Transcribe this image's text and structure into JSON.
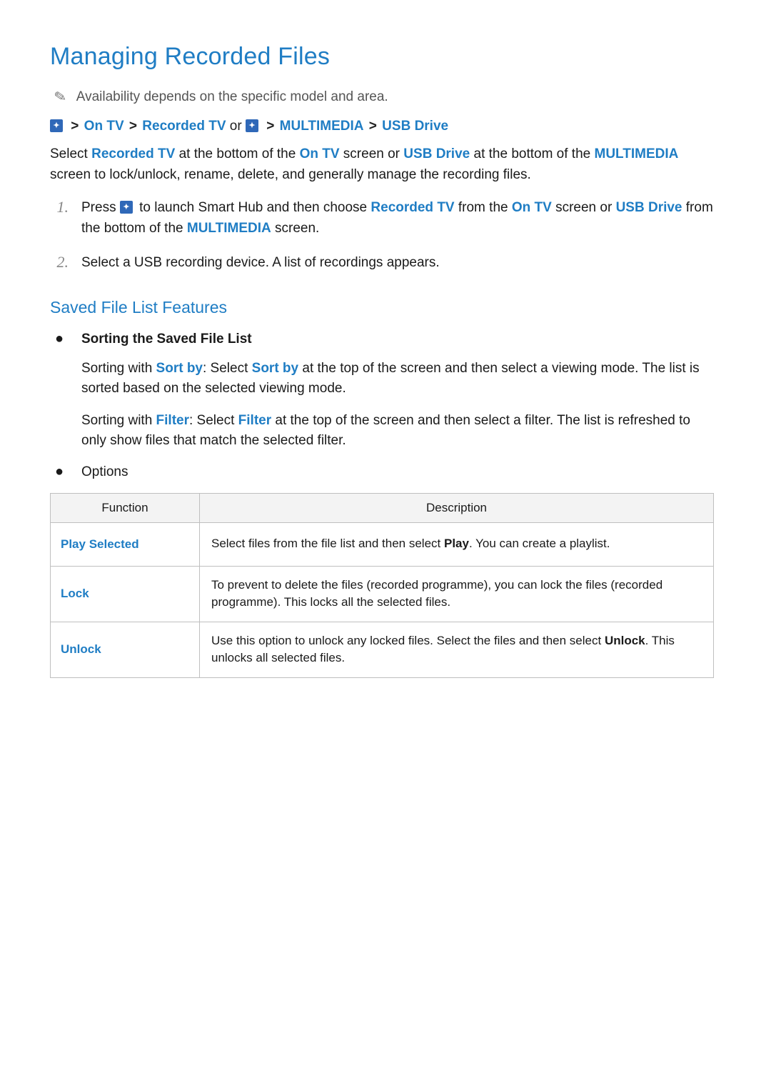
{
  "title": "Managing Recorded Files",
  "note": "Availability depends on the specific model and area.",
  "breadcrumb": {
    "path1": {
      "seg1": "On TV",
      "seg2": "Recorded TV"
    },
    "or": "or",
    "path2": {
      "seg1": "MULTIMEDIA",
      "seg2": "USB Drive"
    },
    "sep": ">"
  },
  "intro": {
    "pre1": "Select ",
    "kw1": "Recorded TV",
    "mid1": " at the bottom of the ",
    "kw2": "On TV",
    "mid2": " screen or ",
    "kw3": "USB Drive",
    "mid3": " at the bottom of the ",
    "kw4": "MULTIMEDIA",
    "post": " screen to lock/unlock, rename, delete, and generally manage the recording files."
  },
  "steps": [
    {
      "num": "1.",
      "pre": "Press ",
      "mid1": " to launch Smart Hub and then choose ",
      "kw1": "Recorded TV",
      "mid2": " from the ",
      "kw2": "On TV",
      "mid3": " screen or ",
      "kw3": "USB Drive",
      "mid4": " from the bottom of the ",
      "kw4": "MULTIMEDIA",
      "post": " screen."
    },
    {
      "num": "2.",
      "text": "Select a USB recording device. A list of recordings appears."
    }
  ],
  "subhead": "Saved File List Features",
  "features": {
    "sorting": {
      "title": "Sorting the Saved File List",
      "p1": {
        "pre": "Sorting with ",
        "kw1": "Sort by",
        "mid1": ": Select ",
        "kw2": "Sort by",
        "post": " at the top of the screen and then select a viewing mode. The list is sorted based on the selected viewing mode."
      },
      "p2": {
        "pre": "Sorting with ",
        "kw1": "Filter",
        "mid1": ": Select ",
        "kw2": "Filter",
        "post": " at the top of the screen and then select a filter. The list is refreshed to only show files that match the selected filter."
      }
    },
    "options_label": "Options"
  },
  "table": {
    "headers": {
      "func": "Function",
      "desc": "Description"
    },
    "rows": [
      {
        "func": "Play Selected",
        "desc_pre": "Select files from the file list and then select ",
        "desc_kw": "Play",
        "desc_post": ". You can create a playlist."
      },
      {
        "func": "Lock",
        "desc_plain": "To prevent to delete the files (recorded programme), you can lock the files (recorded programme). This locks all the selected files."
      },
      {
        "func": "Unlock",
        "desc_pre": "Use this option to unlock any locked files. Select the files and then select ",
        "desc_kw": "Unlock",
        "desc_post": ". This unlocks all selected files."
      }
    ]
  }
}
